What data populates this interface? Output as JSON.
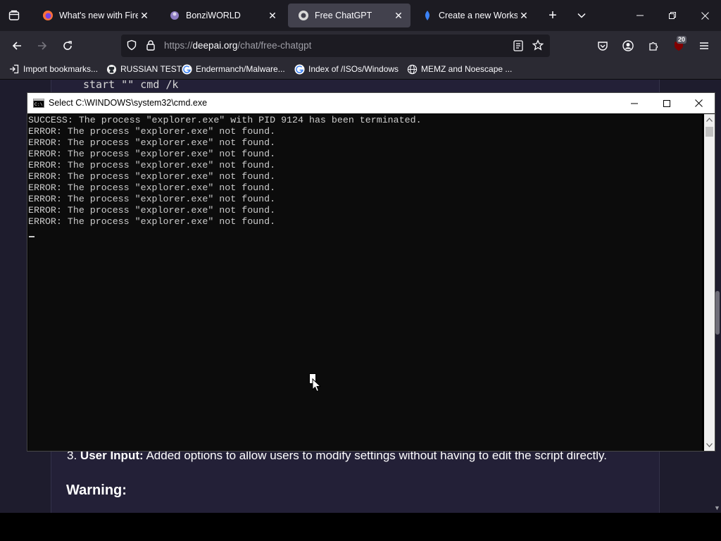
{
  "browser": {
    "tabs": [
      {
        "title": "What's new with Firefo",
        "icon": "firefox-icon"
      },
      {
        "title": "BonziWORLD",
        "icon": "bonzi-icon"
      },
      {
        "title": "Free ChatGPT",
        "icon": "deepai-icon",
        "selected": true
      },
      {
        "title": "Create a new Workspac",
        "icon": "workspace-icon"
      }
    ],
    "url": {
      "prefix": "https://",
      "host": "deepai.org",
      "path": "/chat/free-chatgpt"
    },
    "extension_badge": "20",
    "bookmarks": [
      {
        "label": "Import bookmarks...",
        "icon": "import-icon"
      },
      {
        "label": "RUSSIAN TEST",
        "icon": "github-icon"
      },
      {
        "label": "Endermanch/Malware...",
        "icon": "google-icon"
      },
      {
        "label": "Index of /ISOs/Windows",
        "icon": "google-icon"
      },
      {
        "label": "MEMZ and Noescape ...",
        "icon": "globe-icon"
      }
    ]
  },
  "page": {
    "code_peek": "start \"\" cmd /k",
    "point": {
      "number": "3.",
      "bold": "User Input:",
      "text": " Added options to allow users to modify settings without having to edit the script directly."
    },
    "warning_heading": "Warning:"
  },
  "cmd": {
    "title": "Select C:\\WINDOWS\\system32\\cmd.exe",
    "lines": [
      "SUCCESS: The process \"explorer.exe\" with PID 9124 has been terminated.",
      "ERROR: The process \"explorer.exe\" not found.",
      "ERROR: The process \"explorer.exe\" not found.",
      "ERROR: The process \"explorer.exe\" not found.",
      "ERROR: The process \"explorer.exe\" not found.",
      "ERROR: The process \"explorer.exe\" not found.",
      "ERROR: The process \"explorer.exe\" not found.",
      "ERROR: The process \"explorer.exe\" not found.",
      "ERROR: The process \"explorer.exe\" not found.",
      "ERROR: The process \"explorer.exe\" not found."
    ]
  },
  "colors": {
    "browser_bg": "#1c1b22",
    "toolbar_bg": "#2b2a33",
    "page_bg": "#1e1c2d",
    "console_text": "#cccccc"
  }
}
